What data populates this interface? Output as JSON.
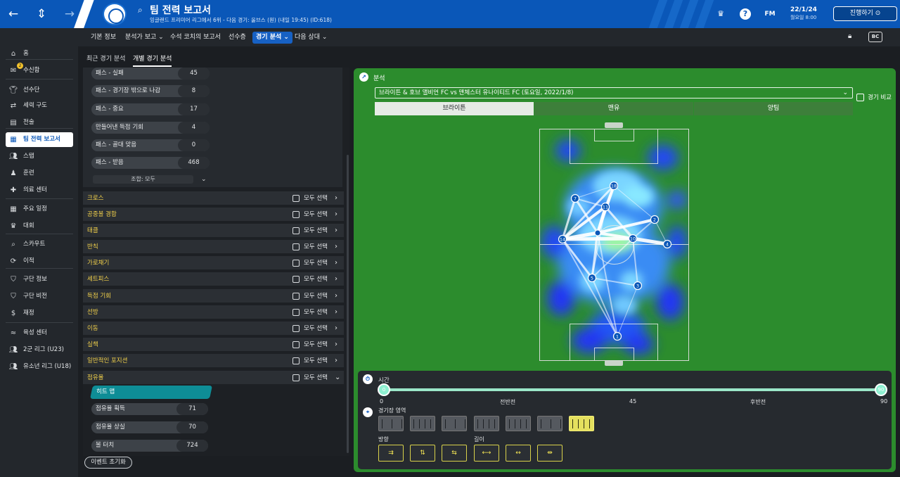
{
  "header": {
    "title": "팀 전력 보고서",
    "subtitle": "잉글랜드 프리미어 리그에서 6위 - 다음 경기: 울브스 (원) (내일 19:45) (ID:618)",
    "date": "22/1/24",
    "time": "월요일 8:00",
    "continue_label": "진행하기",
    "fm_label": "FM"
  },
  "sidebar": {
    "items": [
      {
        "label": "홈",
        "icon": "home-icon"
      },
      {
        "label": "수신함",
        "icon": "inbox-icon",
        "badge": "2"
      },
      {
        "label": "선수단",
        "icon": "shirt-icon"
      },
      {
        "label": "세력 구도",
        "icon": "dynamics-icon"
      },
      {
        "label": "전술",
        "icon": "tactics-icon"
      },
      {
        "label": "팀 전력 보고서",
        "icon": "report-icon"
      },
      {
        "label": "스탭",
        "icon": "staff-icon"
      },
      {
        "label": "훈련",
        "icon": "training-icon"
      },
      {
        "label": "의료 센터",
        "icon": "medical-icon"
      },
      {
        "label": "주요 일정",
        "icon": "calendar-icon"
      },
      {
        "label": "대회",
        "icon": "trophy-icon"
      },
      {
        "label": "스카우트",
        "icon": "scout-icon"
      },
      {
        "label": "이적",
        "icon": "transfer-icon"
      },
      {
        "label": "구단 정보",
        "icon": "club-icon"
      },
      {
        "label": "구단 비전",
        "icon": "vision-icon"
      },
      {
        "label": "재정",
        "icon": "finance-icon"
      },
      {
        "label": "육성 센터",
        "icon": "development-icon"
      },
      {
        "label": "2군 리그 (U23)",
        "icon": "u23-icon"
      },
      {
        "label": "유소년 리그 (U18)",
        "icon": "u18-icon"
      }
    ]
  },
  "subnav": {
    "items": [
      "기본 정보",
      "분석가 보고 ⌄",
      "수석 코치의 보고서",
      "선수층",
      "경기 분석 ⌄",
      "다음 상대 ⌄"
    ]
  },
  "subtabs": [
    "최근 경기 분석",
    "개별 경기 분석"
  ],
  "pass_stats": [
    {
      "label": "패스 - 실패",
      "value": "45"
    },
    {
      "label": "패스 - 경기장 밖으로 나감",
      "value": "8"
    },
    {
      "label": "패스 - 중요",
      "value": "17"
    },
    {
      "label": "만들어낸 득점 기회",
      "value": "4"
    },
    {
      "label": "패스 - 골대 맞음",
      "value": "0"
    },
    {
      "label": "패스 - 받음",
      "value": "468"
    }
  ],
  "combo_label": "조합: 모두",
  "categories": [
    "크로스",
    "공중볼 경합",
    "태클",
    "반칙",
    "가로채기",
    "세트피스",
    "득점 기회",
    "선방",
    "이동",
    "실책",
    "일반적인 포지션",
    "점유율"
  ],
  "select_all_label": "모두 선택",
  "possession": {
    "heatmap_label": "히트 맵",
    "rows": [
      {
        "label": "점유율 획득",
        "value": "71"
      },
      {
        "label": "점유율 상실",
        "value": "70"
      },
      {
        "label": "볼 터치",
        "value": "724"
      }
    ]
  },
  "reset_label": "이벤트 초기화",
  "analysis": {
    "title": "분석",
    "match": "브라이튼 & 호브 앨비언 FC vs 맨체스터 유나이티드 FC (토요일, 2022/1/8)",
    "compare_label": "경기 비교",
    "team_tabs": [
      "브라이튼",
      "맨유",
      "양팀"
    ],
    "players": [
      "18",
      "7",
      "11",
      "2",
      "14",
      "10",
      "4",
      "5",
      "3",
      "1"
    ]
  },
  "timeline": {
    "label": "시간",
    "start": "0",
    "end": "90",
    "first_half": "전반전",
    "mid": "45",
    "second_half": "후반전",
    "knob_start": "0",
    "knob_end": "90"
  },
  "zone_label": "경기장 영역",
  "direction_label": "방향",
  "length_label": "길이",
  "colors": {
    "brand": "#0a57b8",
    "pitch": "#2c8c2d",
    "accent": "#0e8d96",
    "highlight": "#e5e05e"
  }
}
